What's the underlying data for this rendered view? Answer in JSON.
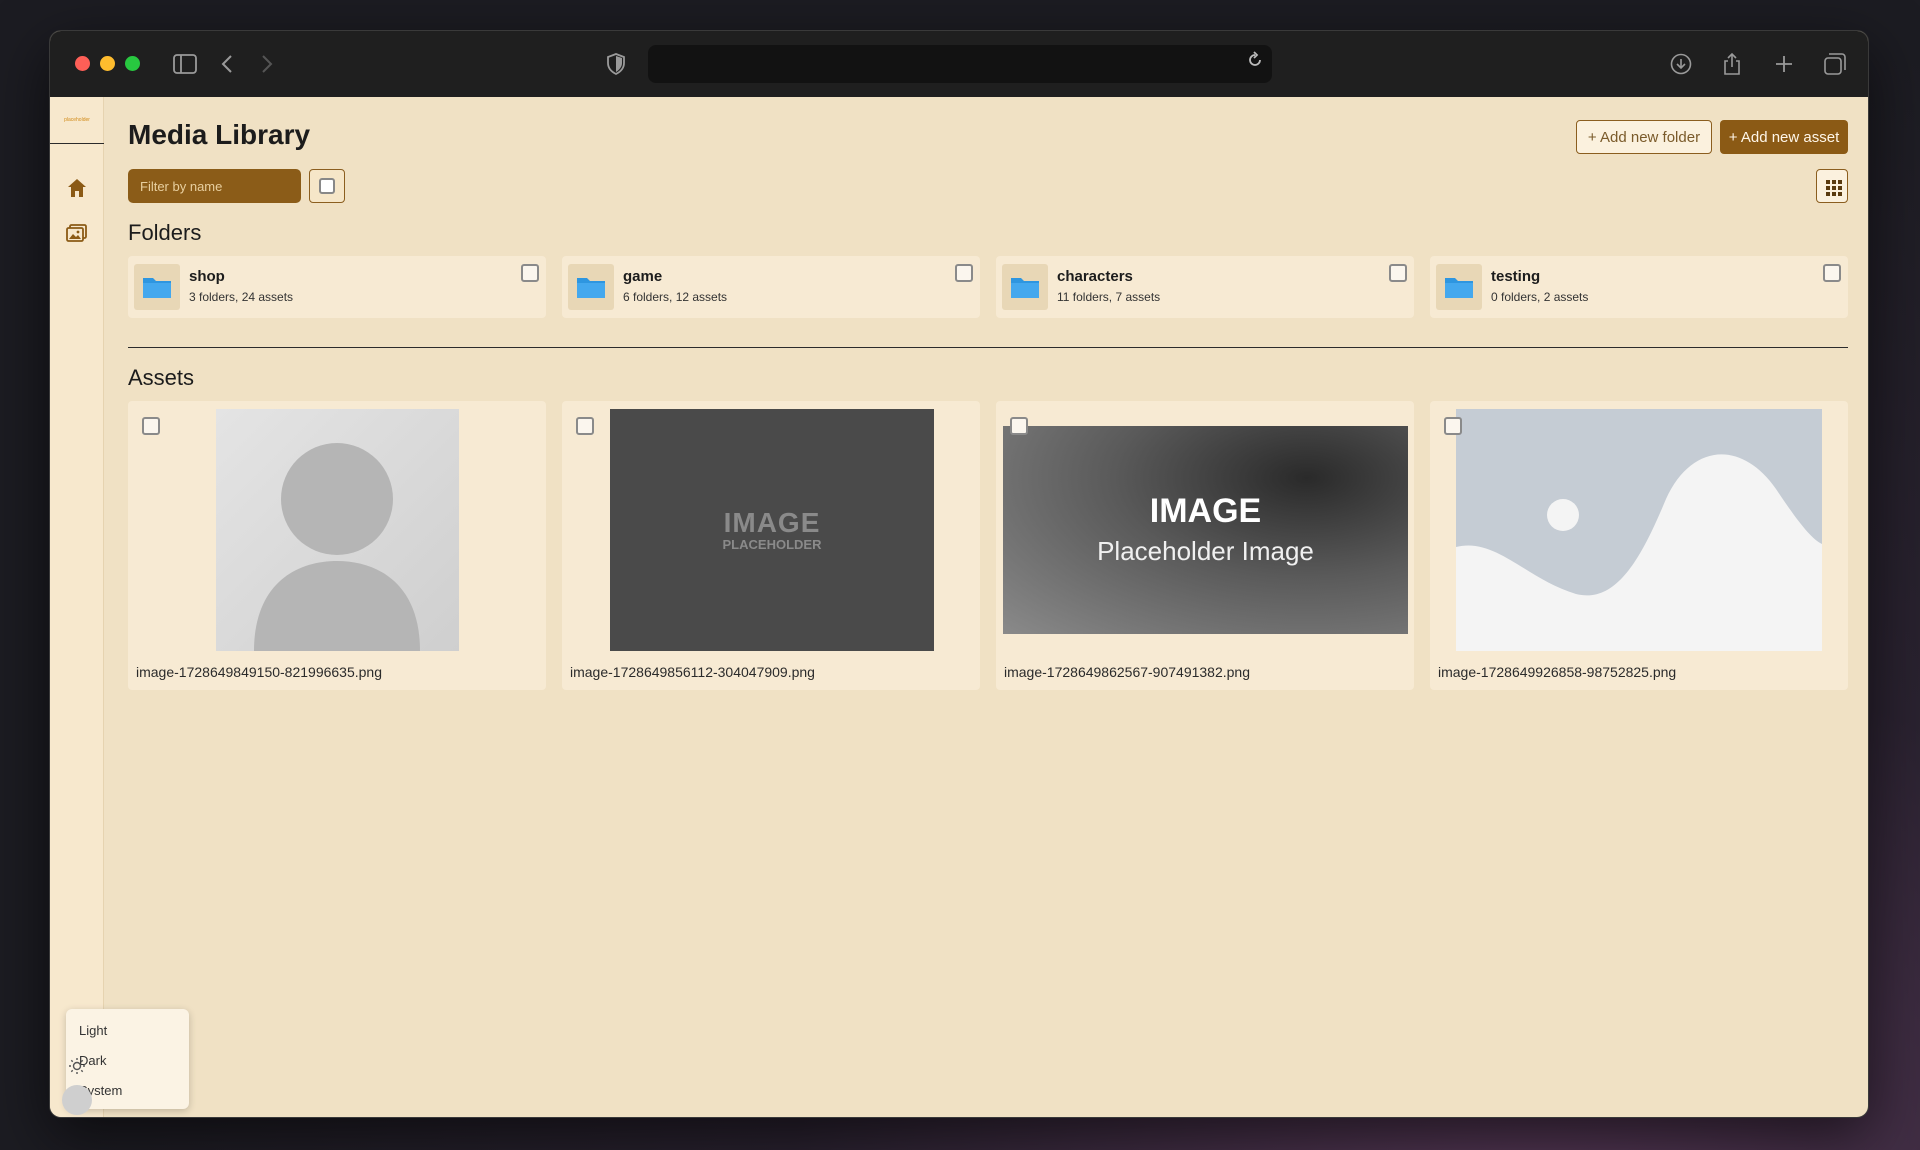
{
  "browser": {
    "url": ""
  },
  "sidebar": {
    "logo_text": "placeholder",
    "theme_menu": [
      "Light",
      "Dark",
      "System"
    ]
  },
  "header": {
    "title": "Media Library",
    "add_folder_label": "+ Add new folder",
    "add_asset_label": "+ Add new asset"
  },
  "filter": {
    "placeholder": "Filter by name"
  },
  "folders_section": {
    "title": "Folders",
    "items": [
      {
        "name": "shop",
        "meta": "3 folders, 24 assets"
      },
      {
        "name": "game",
        "meta": "6 folders, 12 assets"
      },
      {
        "name": "characters",
        "meta": "11 folders, 7 assets"
      },
      {
        "name": "testing",
        "meta": "0 folders, 2 assets"
      }
    ]
  },
  "assets_section": {
    "title": "Assets",
    "items": [
      {
        "file": "image-1728649849150-821996635.png"
      },
      {
        "file": "image-1728649856112-304047909.png",
        "img_title": "IMAGE",
        "img_sub": "PLACEHOLDER"
      },
      {
        "file": "image-1728649862567-907491382.png",
        "img_title": "IMAGE",
        "img_sub": "Placeholder Image"
      },
      {
        "file": "image-1728649926858-98752825.png"
      }
    ]
  },
  "colors": {
    "accent": "#8b5a15",
    "background": "#f0e1c4",
    "folder_icon": "#2e96e0"
  }
}
